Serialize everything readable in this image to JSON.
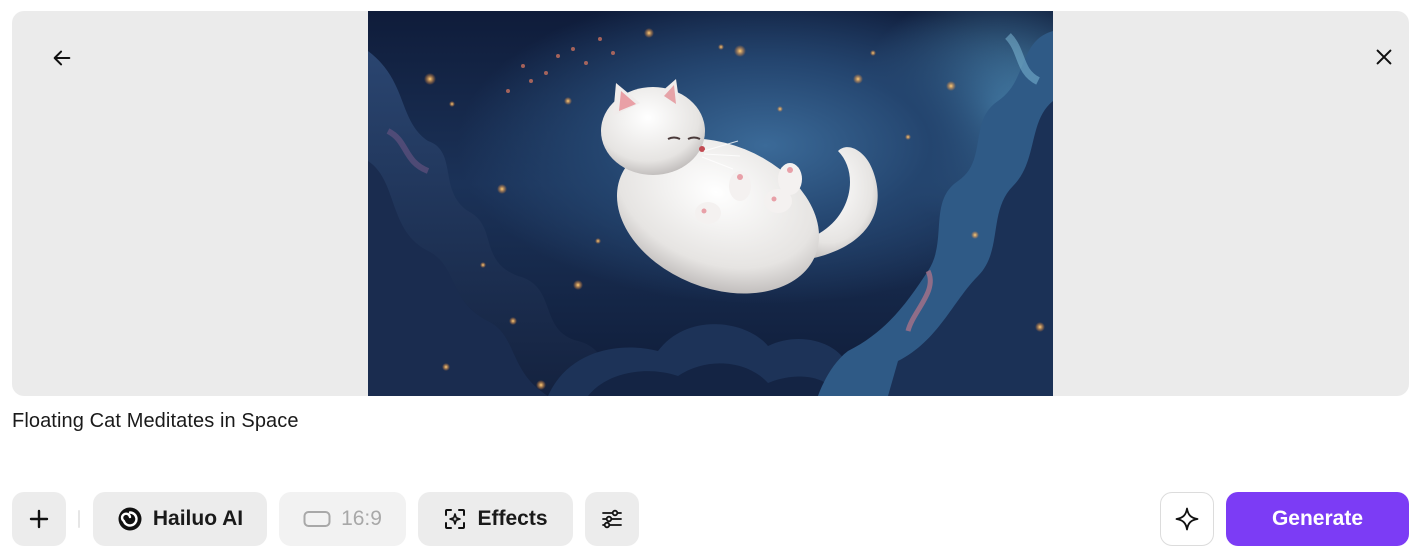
{
  "preview": {
    "image_alt": "White cat floating in a starry night sky among clouds",
    "back_icon": "arrow-left-icon",
    "close_icon": "close-icon"
  },
  "caption": "Floating Cat Meditates in Space",
  "toolbar": {
    "add_icon": "plus-icon",
    "model": {
      "icon": "hailuo-logo-icon",
      "label": "Hailuo AI"
    },
    "aspect_ratio": {
      "icon": "aspect-ratio-icon",
      "label": "16:9"
    },
    "effects": {
      "icon": "effects-icon",
      "label": "Effects"
    },
    "settings_icon": "sliders-icon",
    "enhance_icon": "sparkle-icon",
    "generate_label": "Generate"
  },
  "colors": {
    "accent": "#7c3cf5",
    "button_bg": "#ececec",
    "preview_bg": "#ebebeb"
  }
}
